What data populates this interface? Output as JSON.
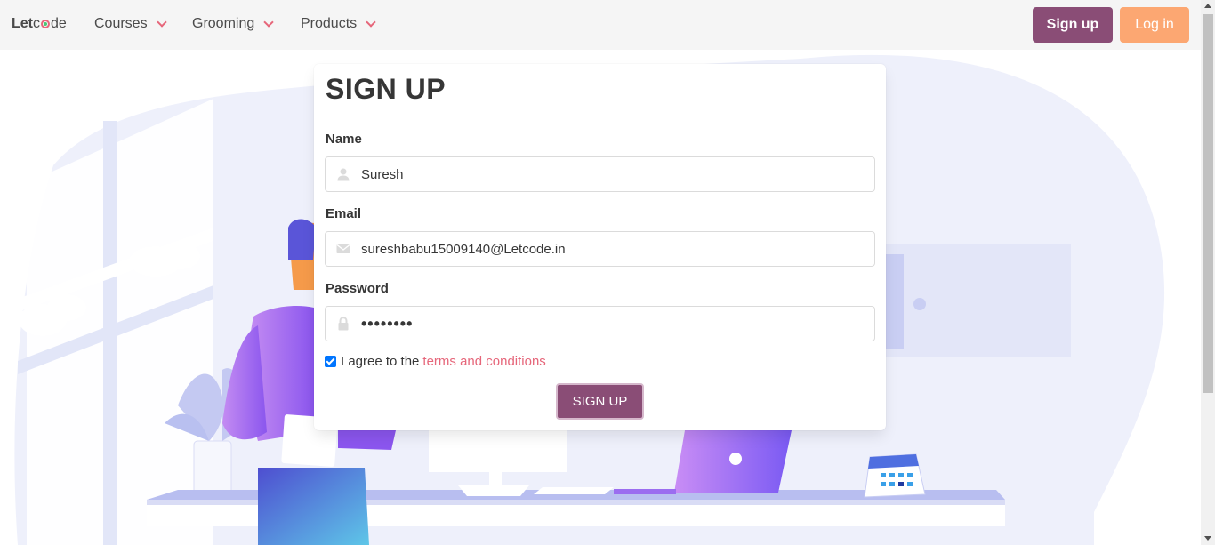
{
  "navbar": {
    "logo_prefix": "Let",
    "logo_suffix": "de",
    "menu": [
      {
        "label": "Courses"
      },
      {
        "label": "Grooming"
      },
      {
        "label": "Products"
      }
    ],
    "signup_label": "Sign up",
    "login_label": "Log in"
  },
  "form": {
    "title": "SIGN UP",
    "name_label": "Name",
    "name_value": "Suresh",
    "email_label": "Email",
    "email_value": "sureshbabu15009140@Letcode.in",
    "password_label": "Password",
    "password_value": "••••••••",
    "agree_text": "I agree to the",
    "terms_text": "terms and conditions",
    "agree_checked": true,
    "submit_label": "SIGN UP"
  },
  "colors": {
    "brand_primary": "#8a4d76",
    "brand_secondary": "#fca772",
    "accent_link": "#e6667a",
    "illustration_light": "#eef0fb",
    "illustration_mid": "#c8cdf2"
  },
  "icons": {
    "name_field": "user-icon",
    "email_field": "envelope-icon",
    "password_field": "lock-icon",
    "menu_chevron": "chevron-down-icon"
  }
}
